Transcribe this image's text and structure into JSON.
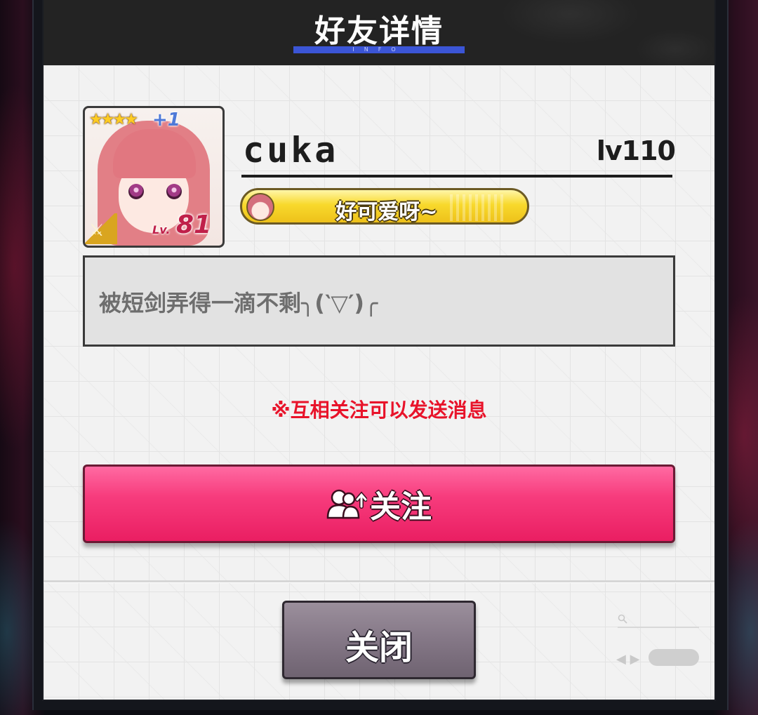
{
  "header": {
    "title": "好友详情",
    "subtitle": "INFO"
  },
  "profile": {
    "username": "cuka",
    "player_level": "lv110",
    "card": {
      "rarity_stars": "★★★★",
      "plus": "+1",
      "lv_label": "Lv.",
      "lv_value": "81"
    },
    "title_badge": "好可爱呀~",
    "bio": "被短剑弄得一滴不剩╮(‵▽′)╭"
  },
  "notice": "※互相关注可以发送消息",
  "buttons": {
    "follow": "关注",
    "close": "关闭"
  },
  "icons": {
    "follow": "add-user-icon",
    "weapon": "sword-icon",
    "search": "search-icon"
  },
  "colors": {
    "follow_button": "#f73c7d",
    "notice_text": "#e8132a",
    "header_accent": "#3b55d6",
    "badge_gold": "#f8d92c"
  }
}
